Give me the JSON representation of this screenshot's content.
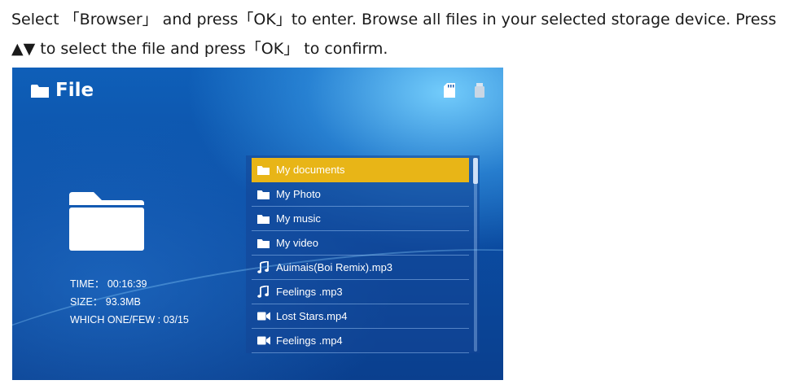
{
  "instructions": {
    "line1": "Select 「Browser」 and press「OK」to enter. Browse all files in your selected storage device. Press",
    "line2": "▲▼ to select the file and press「OK」 to confirm."
  },
  "screen": {
    "title": "File",
    "title_icon": "folder-icon",
    "storage_icons": [
      "sd-card-icon",
      "usb-icon"
    ],
    "info": {
      "time": "TIME： 00:16:39",
      "size": "SIZE： 93.3MB",
      "which": "WHICH ONE/FEW : 03/15"
    },
    "files": [
      {
        "label": "My documents",
        "icon": "folder-icon",
        "selected": true
      },
      {
        "label": "My Photo",
        "icon": "folder-icon",
        "selected": false
      },
      {
        "label": "My music",
        "icon": "folder-icon",
        "selected": false
      },
      {
        "label": "My video",
        "icon": "folder-icon",
        "selected": false
      },
      {
        "label": "Auimais(Boi Remix).mp3",
        "icon": "music-note-icon",
        "selected": false
      },
      {
        "label": "Feelings .mp3",
        "icon": "music-note-icon",
        "selected": false
      },
      {
        "label": "Lost Stars.mp4",
        "icon": "video-icon",
        "selected": false
      },
      {
        "label": "Feelings .mp4",
        "icon": "video-icon",
        "selected": false
      }
    ],
    "colors": {
      "selected": "#e8b517",
      "background": "#0b4ea5"
    }
  }
}
